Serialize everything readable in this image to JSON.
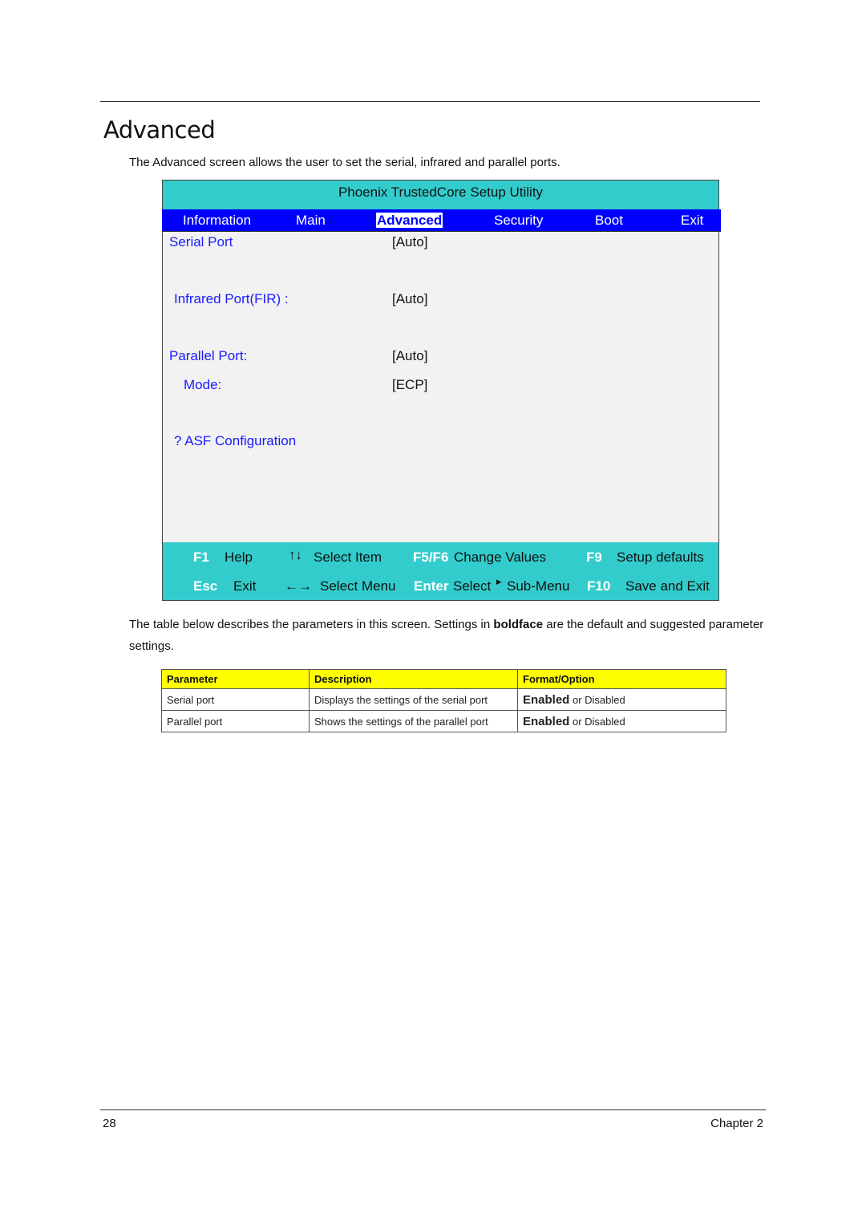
{
  "page": {
    "title": "Advanced",
    "intro": "The Advanced screen allows the user to set the serial, infrared and parallel ports.",
    "description_before_bold": "The table below describes the parameters in this screen. Settings in ",
    "description_bold": "boldface",
    "description_after_bold": " are the default and suggested parameter settings.",
    "page_number": "28",
    "chapter": "Chapter 2"
  },
  "bios": {
    "title": "Phoenix TrustedCore Setup Utility",
    "tabs": [
      {
        "label": "Information",
        "active": false
      },
      {
        "label": "Main",
        "active": false
      },
      {
        "label": "Advanced",
        "active": true
      },
      {
        "label": "Security",
        "active": false
      },
      {
        "label": "Boot",
        "active": false
      },
      {
        "label": "Exit",
        "active": false
      }
    ],
    "items": [
      {
        "label": "Serial Port",
        "value": "[Auto]"
      },
      {
        "label": "Infrared Port(FIR) :",
        "value": "[Auto]"
      },
      {
        "label": "Parallel Port:",
        "value": "[Auto]"
      },
      {
        "label": "Mode:",
        "value": "[ECP]"
      },
      {
        "label": "? ASF Configuration",
        "value": ""
      }
    ],
    "footer": {
      "row1": [
        {
          "key": "F1",
          "desc": "Help"
        },
        {
          "icon": "up-down-arrows",
          "glyph": "↑↓",
          "desc": "Select Item"
        },
        {
          "key": "F5/F6",
          "desc": "Change Values"
        },
        {
          "key": "F9",
          "desc": "Setup defaults"
        }
      ],
      "row2": [
        {
          "key": "Esc",
          "desc": "Exit"
        },
        {
          "icon": "left-right-arrows",
          "glyph": "←→",
          "desc": "Select Menu"
        },
        {
          "key": "Enter",
          "desc": "Select",
          "submenu_glyph": "▸",
          "desc2": "Sub-Menu"
        },
        {
          "key": "F10",
          "desc": "Save and Exit"
        }
      ]
    },
    "colors": {
      "title_bar": "#33cccc",
      "tab_bar": "#0000ff",
      "item_text": "#1a1aff",
      "body_bg": "#f2f2f2"
    }
  },
  "table": {
    "headers": [
      "Parameter",
      "Description",
      "Format/Option"
    ],
    "rows": [
      {
        "parameter": "Serial port",
        "description": "Displays the settings of the serial port",
        "option_default": "Enabled",
        "option_rest": " or Disabled"
      },
      {
        "parameter": "Parallel port",
        "description": "Shows the settings of the parallel port",
        "option_default": "Enabled",
        "option_rest": " or Disabled"
      }
    ],
    "header_color": "#ffff00"
  }
}
